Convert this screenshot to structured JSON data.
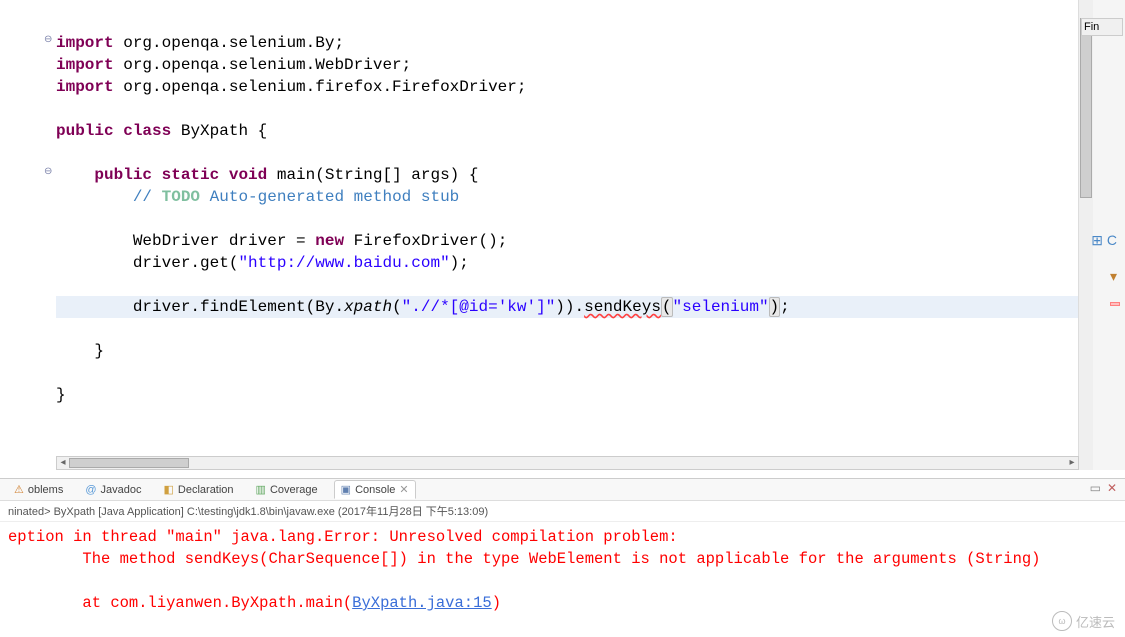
{
  "code": {
    "import1": "import",
    "import1_pkg": " org.openqa.selenium.By;",
    "import2": "import",
    "import2_pkg": " org.openqa.selenium.WebDriver;",
    "import3": "import",
    "import3_pkg": " org.openqa.selenium.firefox.FirefoxDriver;",
    "kw_public": "public",
    "kw_class": "class",
    "class_name": " ByXpath {",
    "kw_public2": "public",
    "kw_static": "static",
    "kw_void": "void",
    "main_sig": " main(String[] args) {",
    "comment_prefix": "// ",
    "comment_todo": "TODO",
    "comment_rest": " Auto-generated method stub",
    "line_webdriver_a": "WebDriver driver = ",
    "kw_new": "new",
    "line_webdriver_b": " FirefoxDriver();",
    "line_get_a": "driver.get(",
    "str_url": "\"http://www.baidu.com\"",
    "line_get_b": ");",
    "line_find_a": "driver.findElement(By.",
    "xpath_method": "xpath",
    "line_find_b": "(",
    "str_xpath": "\".//*[@id='kw']\"",
    "line_find_c": ")).",
    "sendkeys": "sendKeys",
    "line_find_open": "(",
    "str_selenium": "\"selenium\"",
    "line_find_close": ")",
    "line_find_end": ";",
    "close1": "    }",
    "close2": "}"
  },
  "tabs": {
    "problems": "oblems",
    "javadoc": "Javadoc",
    "declaration": "Declaration",
    "coverage": "Coverage",
    "console": "Console"
  },
  "process_line": "ninated> ByXpath [Java Application] C:\\testing\\jdk1.8\\bin\\javaw.exe (2017年11月28日 下午5:13:09)",
  "console": {
    "line1": "eption in thread \"main\" java.lang.Error: Unresolved compilation problem: ",
    "line2": "\tThe method sendKeys(CharSequence[]) in the type WebElement is not applicable for the arguments (String)",
    "line3_a": "\tat com.liyanwen.ByXpath.main(",
    "line3_link": "ByXpath.java:15",
    "line3_b": ")"
  },
  "sidebar": {
    "find": "Fin",
    "outline": "C"
  },
  "watermark": "亿速云"
}
